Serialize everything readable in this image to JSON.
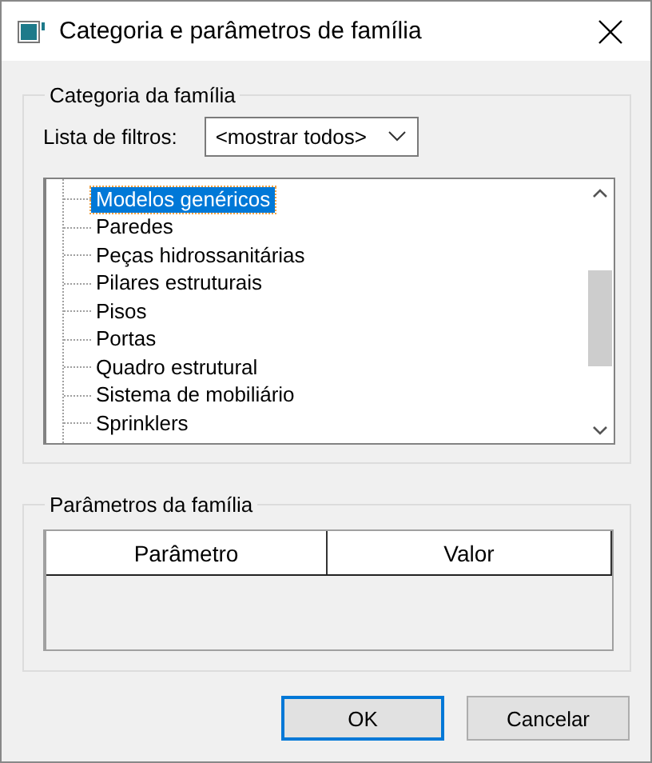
{
  "window": {
    "title": "Categoria e parâmetros de família"
  },
  "category_group": {
    "title": "Categoria da família",
    "filter_label": "Lista de filtros:",
    "filter_value": "<mostrar todos>",
    "items": [
      {
        "label": "Modelos genéricos",
        "selected": true
      },
      {
        "label": "Paredes",
        "selected": false
      },
      {
        "label": "Peças hidrossanitárias",
        "selected": false
      },
      {
        "label": "Pilares estruturais",
        "selected": false
      },
      {
        "label": "Pisos",
        "selected": false
      },
      {
        "label": "Portas",
        "selected": false
      },
      {
        "label": "Quadro estrutural",
        "selected": false
      },
      {
        "label": "Sistema de mobiliário",
        "selected": false
      },
      {
        "label": "Sprinklers",
        "selected": false
      }
    ]
  },
  "parameters_group": {
    "title": "Parâmetros da família",
    "columns": [
      "Parâmetro",
      "Valor"
    ]
  },
  "buttons": [
    {
      "label": "OK",
      "default": true
    },
    {
      "label": "Cancelar",
      "default": false
    }
  ]
}
